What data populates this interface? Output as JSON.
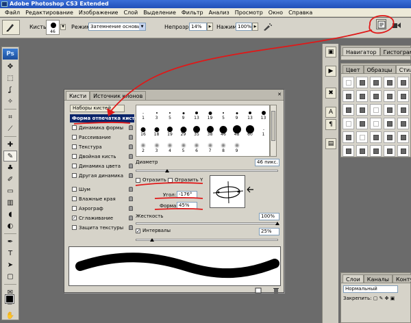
{
  "window": {
    "title": "Adobe Photoshop CS3 Extended",
    "app_icon": "Ps"
  },
  "menu": [
    "Файл",
    "Редактирование",
    "Изображение",
    "Слой",
    "Выделение",
    "Фильтр",
    "Анализ",
    "Просмотр",
    "Окно",
    "Справка"
  ],
  "options_bar": {
    "brush_label": "Кисть:",
    "brush_size": "46",
    "mode_label": "Режим:",
    "mode_value": "Затемнение основы",
    "opacity_label": "Непрозр.:",
    "opacity_value": "14%",
    "flow_label": "Нажим:",
    "flow_value": "100%"
  },
  "toolbox": {
    "logo": "Ps",
    "icons": [
      "move-icon",
      "marquee-icon",
      "lasso-icon",
      "magic-wand-icon",
      "crop-icon",
      "slice-icon",
      "healing-icon",
      "brush-icon",
      "stamp-icon",
      "history-brush-icon",
      "eraser-icon",
      "gradient-icon",
      "blur-icon",
      "dodge-icon",
      "pen-icon",
      "type-icon",
      "path-select-icon",
      "shape-icon",
      "notes-icon",
      "eyedropper-icon",
      "hand-icon",
      "zoom-icon"
    ]
  },
  "right_panels": {
    "navigator_tabs": [
      "Навигатор",
      "Гистограмма"
    ],
    "styles_tabs": [
      "Цвет",
      "Образцы",
      "Стили"
    ],
    "layers_tabs": [
      "Слои",
      "Каналы",
      "Контуры"
    ],
    "layers_mode": "Нормальный",
    "layers_lock_label": "Закрепить:"
  },
  "brushes_dialog": {
    "tabs": [
      "Кисти",
      "Источник клонов"
    ],
    "presets_button": "Наборы кистей",
    "options": [
      {
        "label": "Форма отпечатка кисти",
        "checked": false,
        "selected": true,
        "lock": false
      },
      {
        "label": "Динамика формы",
        "checked": false,
        "selected": false,
        "lock": true
      },
      {
        "label": "Рассеивание",
        "checked": false,
        "selected": false,
        "lock": true
      },
      {
        "label": "Текстура",
        "checked": false,
        "selected": false,
        "lock": true
      },
      {
        "label": "Двойная кисть",
        "checked": false,
        "selected": false,
        "lock": true
      },
      {
        "label": "Динамика цвета",
        "checked": false,
        "selected": false,
        "lock": true
      },
      {
        "label": "Другая динамика",
        "checked": false,
        "selected": false,
        "lock": true
      },
      {
        "label": "Шум",
        "checked": false,
        "selected": false,
        "lock": true
      },
      {
        "label": "Влажные края",
        "checked": false,
        "selected": false,
        "lock": true
      },
      {
        "label": "Аэрограф",
        "checked": false,
        "selected": false,
        "lock": true
      },
      {
        "label": "Сглаживание",
        "checked": true,
        "selected": false,
        "lock": true
      },
      {
        "label": "Защита текстуры",
        "checked": false,
        "selected": false,
        "lock": true
      }
    ],
    "brush_tips": [
      {
        "num": "1",
        "d": 1
      },
      {
        "num": "3",
        "d": 2
      },
      {
        "num": "5",
        "d": 2
      },
      {
        "num": "9",
        "d": 3
      },
      {
        "num": "13",
        "d": 4
      },
      {
        "num": "19",
        "d": 5
      },
      {
        "num": "5",
        "d": 2
      },
      {
        "num": "9",
        "d": 3
      },
      {
        "num": "13",
        "d": 4
      },
      {
        "num": "13",
        "d": 6
      },
      {
        "num": "16",
        "d": 7
      },
      {
        "num": "18",
        "d": 7
      },
      {
        "num": "19",
        "d": 8
      },
      {
        "num": "29",
        "d": 9
      },
      {
        "num": "35",
        "d": 10
      },
      {
        "num": "38",
        "d": 10
      },
      {
        "num": "46",
        "d": 11
      },
      {
        "num": "48",
        "d": 12
      },
      {
        "num": "60",
        "d": 12
      },
      {
        "num": "1",
        "d": 1
      },
      {
        "num": "2",
        "d": 1
      },
      {
        "num": "3",
        "d": 1
      },
      {
        "num": "4",
        "d": 1
      },
      {
        "num": "5",
        "d": 1
      },
      {
        "num": "6",
        "d": 1
      },
      {
        "num": "7",
        "d": 1
      },
      {
        "num": "8",
        "d": 1
      },
      {
        "num": "9",
        "d": 1
      }
    ],
    "diameter_label": "Диаметр",
    "diameter_value": "46 пикс.",
    "flip_x_label": "Отразить X",
    "flip_y_label": "Отразить Y",
    "angle_label": "Угол:",
    "angle_value": "-176°",
    "roundness_label": "Форма:",
    "roundness_value": "45%",
    "hardness_label": "Жесткость",
    "hardness_value": "100%",
    "spacing_label": "Интервалы",
    "spacing_value": "25%",
    "spacing_checked": true
  },
  "colors": {
    "annotation": "#e01818",
    "selection": "#0a246a"
  }
}
